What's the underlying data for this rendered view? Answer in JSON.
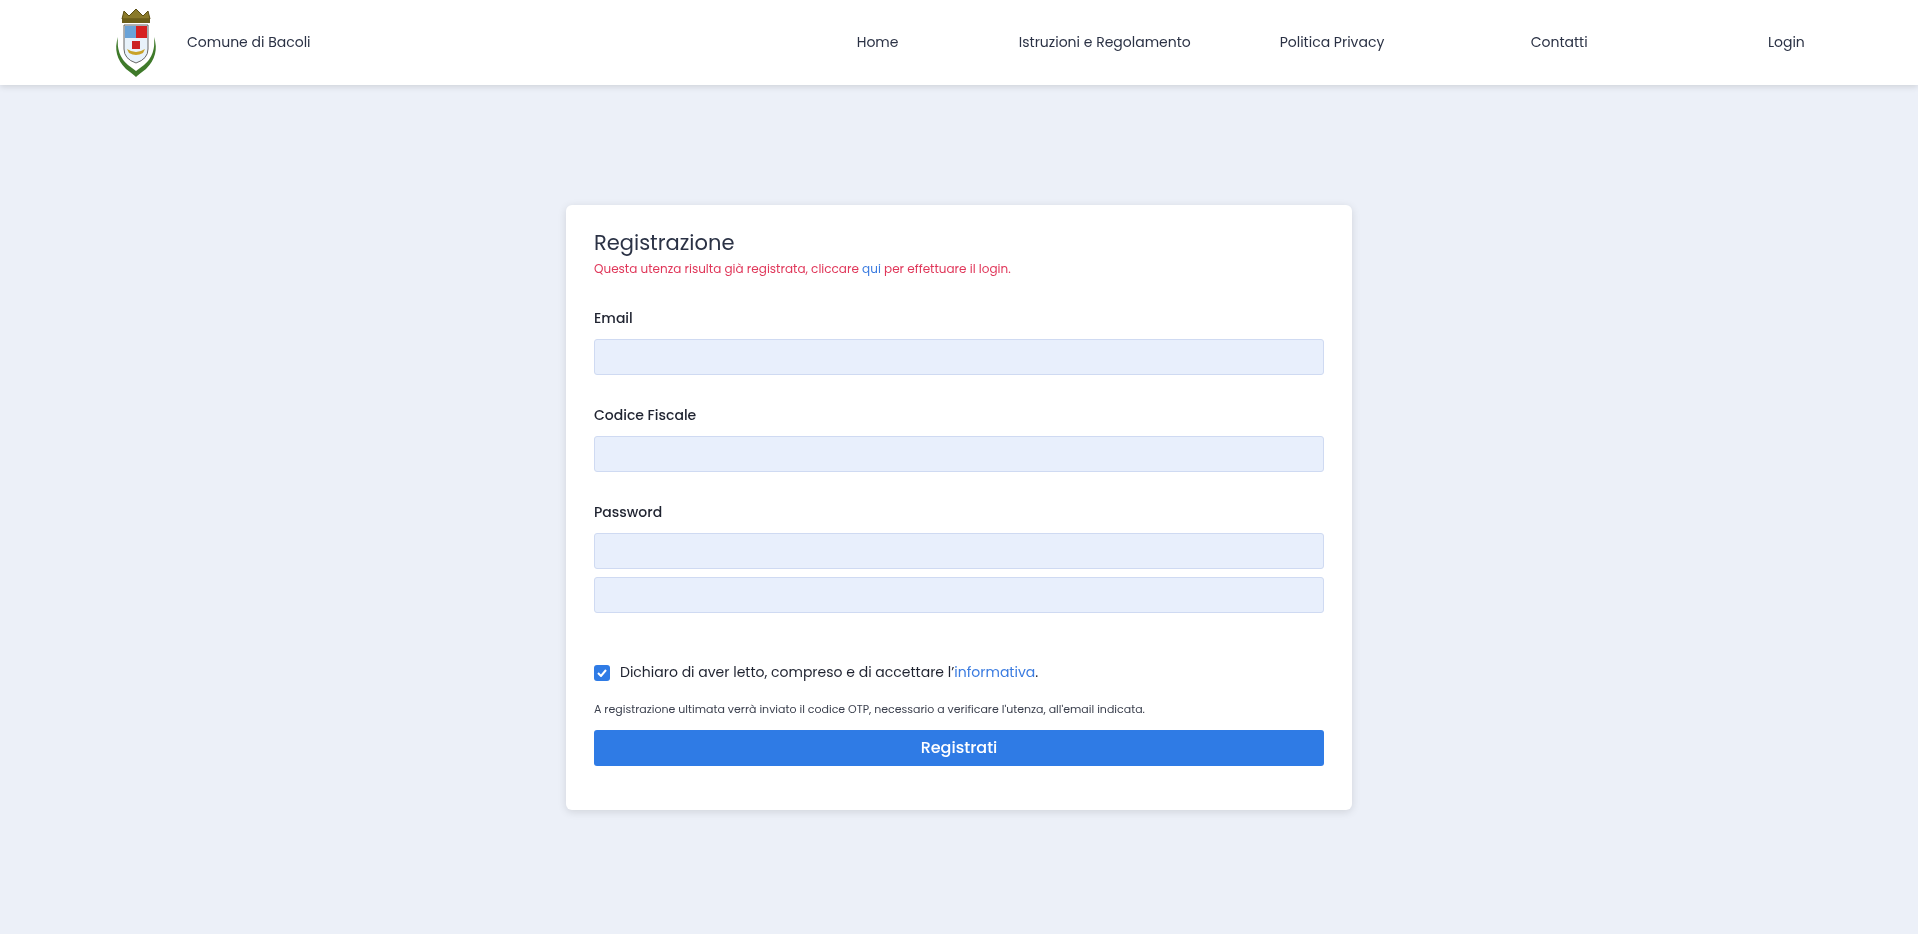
{
  "header": {
    "brand": "Comune di Bacoli",
    "nav": [
      {
        "label": "Home"
      },
      {
        "label": "Istruzioni e Regolamento"
      },
      {
        "label": "Politica Privacy"
      },
      {
        "label": "Contatti"
      },
      {
        "label": "Login"
      }
    ]
  },
  "form": {
    "title": "Registrazione",
    "notice": {
      "before": "Questa utenza risulta già registrata, cliccare ",
      "link": "qui",
      "after": " per effettuare il login."
    },
    "fields": [
      {
        "label": "Email",
        "kind": "single"
      },
      {
        "label": "Codice Fiscale",
        "kind": "single"
      },
      {
        "label": "Password",
        "kind": "double"
      }
    ],
    "consent": {
      "checked": true,
      "before": "Dichiaro di aver letto, compreso e di accettare l’",
      "link": "informativa",
      "after": "."
    },
    "note": "A registrazione ultimata verrà inviato il codice OTP, necessario a verificare l'utenza, all'email indicata.",
    "submit": "Registrati"
  }
}
